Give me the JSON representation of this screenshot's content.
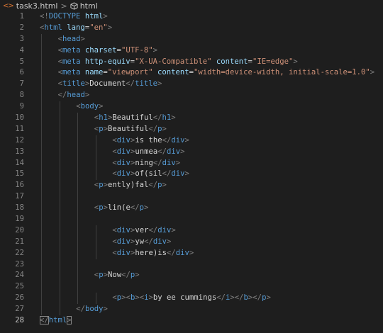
{
  "breadcrumb": {
    "file_icon": "<>",
    "filename": "task3.html",
    "separator": ">",
    "element": "html"
  },
  "lines": [
    {
      "n": "1",
      "indent": 0,
      "tokens": [
        [
          "p",
          "<!"
        ],
        [
          "t",
          "DOCTYPE"
        ],
        [
          "x",
          " "
        ],
        [
          "a",
          "html"
        ],
        [
          "p",
          ">"
        ]
      ]
    },
    {
      "n": "2",
      "indent": 0,
      "tokens": [
        [
          "p",
          "<"
        ],
        [
          "t",
          "html"
        ],
        [
          "x",
          " "
        ],
        [
          "a",
          "lang"
        ],
        [
          "x",
          "="
        ],
        [
          "s",
          "\"en\""
        ],
        [
          "p",
          ">"
        ]
      ]
    },
    {
      "n": "3",
      "indent": 1,
      "tokens": [
        [
          "p",
          "<"
        ],
        [
          "t",
          "head"
        ],
        [
          "p",
          ">"
        ]
      ]
    },
    {
      "n": "4",
      "indent": 1,
      "tokens": [
        [
          "p",
          "<"
        ],
        [
          "t",
          "meta"
        ],
        [
          "x",
          " "
        ],
        [
          "a",
          "charset"
        ],
        [
          "x",
          "="
        ],
        [
          "s",
          "\"UTF-8\""
        ],
        [
          "p",
          ">"
        ]
      ]
    },
    {
      "n": "5",
      "indent": 1,
      "tokens": [
        [
          "p",
          "<"
        ],
        [
          "t",
          "meta"
        ],
        [
          "x",
          " "
        ],
        [
          "a",
          "http-equiv"
        ],
        [
          "x",
          "="
        ],
        [
          "s",
          "\"X-UA-Compatible\""
        ],
        [
          "x",
          " "
        ],
        [
          "a",
          "content"
        ],
        [
          "x",
          "="
        ],
        [
          "s",
          "\"IE=edge\""
        ],
        [
          "p",
          ">"
        ]
      ]
    },
    {
      "n": "6",
      "indent": 1,
      "tokens": [
        [
          "p",
          "<"
        ],
        [
          "t",
          "meta"
        ],
        [
          "x",
          " "
        ],
        [
          "a",
          "name"
        ],
        [
          "x",
          "="
        ],
        [
          "s",
          "\"viewport\""
        ],
        [
          "x",
          " "
        ],
        [
          "a",
          "content"
        ],
        [
          "x",
          "="
        ],
        [
          "s",
          "\"width=device-width, initial-scale=1.0\""
        ],
        [
          "p",
          ">"
        ]
      ]
    },
    {
      "n": "7",
      "indent": 1,
      "tokens": [
        [
          "p",
          "<"
        ],
        [
          "t",
          "title"
        ],
        [
          "p",
          ">"
        ],
        [
          "x",
          "Document"
        ],
        [
          "p",
          "</"
        ],
        [
          "t",
          "title"
        ],
        [
          "p",
          ">"
        ]
      ]
    },
    {
      "n": "8",
      "indent": 1,
      "tokens": [
        [
          "p",
          "</"
        ],
        [
          "t",
          "head"
        ],
        [
          "p",
          ">"
        ]
      ]
    },
    {
      "n": "9",
      "indent": 2,
      "tokens": [
        [
          "p",
          "<"
        ],
        [
          "t",
          "body"
        ],
        [
          "p",
          ">"
        ]
      ]
    },
    {
      "n": "10",
      "indent": 3,
      "tokens": [
        [
          "p",
          "<"
        ],
        [
          "t",
          "h1"
        ],
        [
          "p",
          ">"
        ],
        [
          "x",
          "Beautiful"
        ],
        [
          "p",
          "</"
        ],
        [
          "t",
          "h1"
        ],
        [
          "p",
          ">"
        ]
      ]
    },
    {
      "n": "11",
      "indent": 3,
      "tokens": [
        [
          "p",
          "<"
        ],
        [
          "t",
          "p"
        ],
        [
          "p",
          ">"
        ],
        [
          "x",
          "Beautiful"
        ],
        [
          "p",
          "</"
        ],
        [
          "t",
          "p"
        ],
        [
          "p",
          ">"
        ]
      ]
    },
    {
      "n": "12",
      "indent": 4,
      "tokens": [
        [
          "p",
          "<"
        ],
        [
          "t",
          "div"
        ],
        [
          "p",
          ">"
        ],
        [
          "x",
          "is the"
        ],
        [
          "p",
          "</"
        ],
        [
          "t",
          "div"
        ],
        [
          "p",
          ">"
        ]
      ]
    },
    {
      "n": "13",
      "indent": 4,
      "tokens": [
        [
          "p",
          "<"
        ],
        [
          "t",
          "div"
        ],
        [
          "p",
          ">"
        ],
        [
          "x",
          "unmea"
        ],
        [
          "p",
          "</"
        ],
        [
          "t",
          "div"
        ],
        [
          "p",
          ">"
        ]
      ]
    },
    {
      "n": "14",
      "indent": 4,
      "tokens": [
        [
          "p",
          "<"
        ],
        [
          "t",
          "div"
        ],
        [
          "p",
          ">"
        ],
        [
          "x",
          "ning"
        ],
        [
          "p",
          "</"
        ],
        [
          "t",
          "div"
        ],
        [
          "p",
          ">"
        ]
      ]
    },
    {
      "n": "15",
      "indent": 4,
      "tokens": [
        [
          "p",
          "<"
        ],
        [
          "t",
          "div"
        ],
        [
          "p",
          ">"
        ],
        [
          "x",
          "of(sil"
        ],
        [
          "p",
          "</"
        ],
        [
          "t",
          "div"
        ],
        [
          "p",
          ">"
        ]
      ]
    },
    {
      "n": "16",
      "indent": 3,
      "tokens": [
        [
          "p",
          "<"
        ],
        [
          "t",
          "p"
        ],
        [
          "p",
          ">"
        ],
        [
          "x",
          "ently)fal"
        ],
        [
          "p",
          "</"
        ],
        [
          "t",
          "p"
        ],
        [
          "p",
          ">"
        ]
      ]
    },
    {
      "n": "17",
      "indent": 3,
      "tokens": []
    },
    {
      "n": "18",
      "indent": 3,
      "tokens": [
        [
          "p",
          "<"
        ],
        [
          "t",
          "p"
        ],
        [
          "p",
          ">"
        ],
        [
          "x",
          "lin(e"
        ],
        [
          "p",
          "</"
        ],
        [
          "t",
          "p"
        ],
        [
          "p",
          ">"
        ]
      ]
    },
    {
      "n": "19",
      "indent": 3,
      "tokens": []
    },
    {
      "n": "20",
      "indent": 4,
      "tokens": [
        [
          "p",
          "<"
        ],
        [
          "t",
          "div"
        ],
        [
          "p",
          ">"
        ],
        [
          "x",
          "ver"
        ],
        [
          "p",
          "</"
        ],
        [
          "t",
          "div"
        ],
        [
          "p",
          ">"
        ]
      ]
    },
    {
      "n": "21",
      "indent": 4,
      "tokens": [
        [
          "p",
          "<"
        ],
        [
          "t",
          "div"
        ],
        [
          "p",
          ">"
        ],
        [
          "x",
          "yw"
        ],
        [
          "p",
          "</"
        ],
        [
          "t",
          "div"
        ],
        [
          "p",
          ">"
        ]
      ]
    },
    {
      "n": "22",
      "indent": 4,
      "tokens": [
        [
          "p",
          "<"
        ],
        [
          "t",
          "div"
        ],
        [
          "p",
          ">"
        ],
        [
          "x",
          "here)is"
        ],
        [
          "p",
          "</"
        ],
        [
          "t",
          "div"
        ],
        [
          "p",
          ">"
        ]
      ]
    },
    {
      "n": "23",
      "indent": 3,
      "tokens": []
    },
    {
      "n": "24",
      "indent": 3,
      "tokens": [
        [
          "p",
          "<"
        ],
        [
          "t",
          "p"
        ],
        [
          "p",
          ">"
        ],
        [
          "x",
          "Now"
        ],
        [
          "p",
          "</"
        ],
        [
          "t",
          "p"
        ],
        [
          "p",
          ">"
        ]
      ]
    },
    {
      "n": "25",
      "indent": 3,
      "tokens": []
    },
    {
      "n": "26",
      "indent": 4,
      "tokens": [
        [
          "p",
          "<"
        ],
        [
          "t",
          "p"
        ],
        [
          "p",
          ">"
        ],
        [
          "p",
          "<"
        ],
        [
          "t",
          "b"
        ],
        [
          "p",
          ">"
        ],
        [
          "p",
          "<"
        ],
        [
          "t",
          "i"
        ],
        [
          "p",
          ">"
        ],
        [
          "x",
          "by ee cummings"
        ],
        [
          "p",
          "</"
        ],
        [
          "t",
          "i"
        ],
        [
          "p",
          ">"
        ],
        [
          "p",
          "</"
        ],
        [
          "t",
          "b"
        ],
        [
          "p",
          ">"
        ],
        [
          "p",
          "</"
        ],
        [
          "t",
          "p"
        ],
        [
          "p",
          ">"
        ]
      ]
    },
    {
      "n": "27",
      "indent": 2,
      "tokens": [
        [
          "p",
          "</"
        ],
        [
          "t",
          "body"
        ],
        [
          "p",
          ">"
        ]
      ]
    },
    {
      "n": "28",
      "indent": 0,
      "active": true,
      "tokens": [
        [
          "p",
          "</"
        ],
        [
          "t",
          "html"
        ],
        [
          "p",
          ">"
        ]
      ]
    }
  ],
  "colors": {
    "background": "#1e1e1e",
    "tag": "#569cd6",
    "punctuation": "#808080",
    "attribute": "#9cdcfe",
    "string": "#ce9178",
    "text": "#d4d4d4",
    "line_number": "#858585",
    "active_line_number": "#c6c6c6"
  }
}
